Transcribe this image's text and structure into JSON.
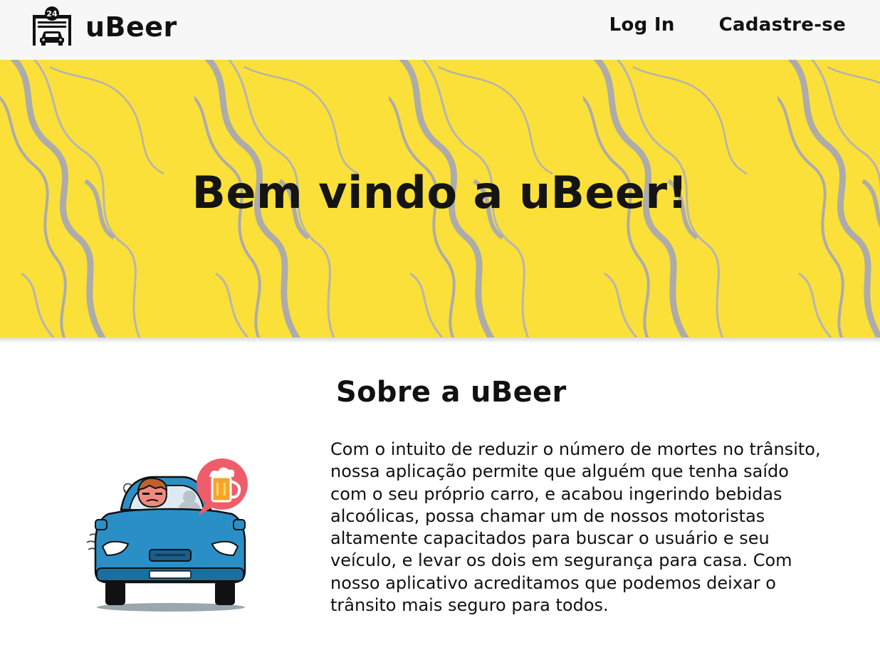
{
  "navbar": {
    "brand": {
      "name": "uBeer",
      "logo_badge": "24",
      "logo_icon": "garage-car-24h-icon"
    },
    "links": [
      {
        "label": "Log In"
      },
      {
        "label": "Cadastre-se"
      }
    ]
  },
  "hero": {
    "title": "Bem vindo a uBeer!",
    "background_color": "#fbe03a",
    "pattern_color": "#a9a9b0"
  },
  "about": {
    "title": "Sobre a uBeer",
    "illustration": "drunk-driver-car-beer-icon",
    "text": "Com o intuito de reduzir o número de mortes no trânsito, nossa aplicação permite que alguém que tenha saído com o seu próprio carro, e acabou ingerindo bebidas alcoólicas, possa chamar um de nossos motoristas altamente capacitados para buscar o usuário e seu veículo, e levar os dois em segurança para casa. Com nosso aplicativo acreditamos que podemos deixar o trânsito mais seguro para todos."
  }
}
